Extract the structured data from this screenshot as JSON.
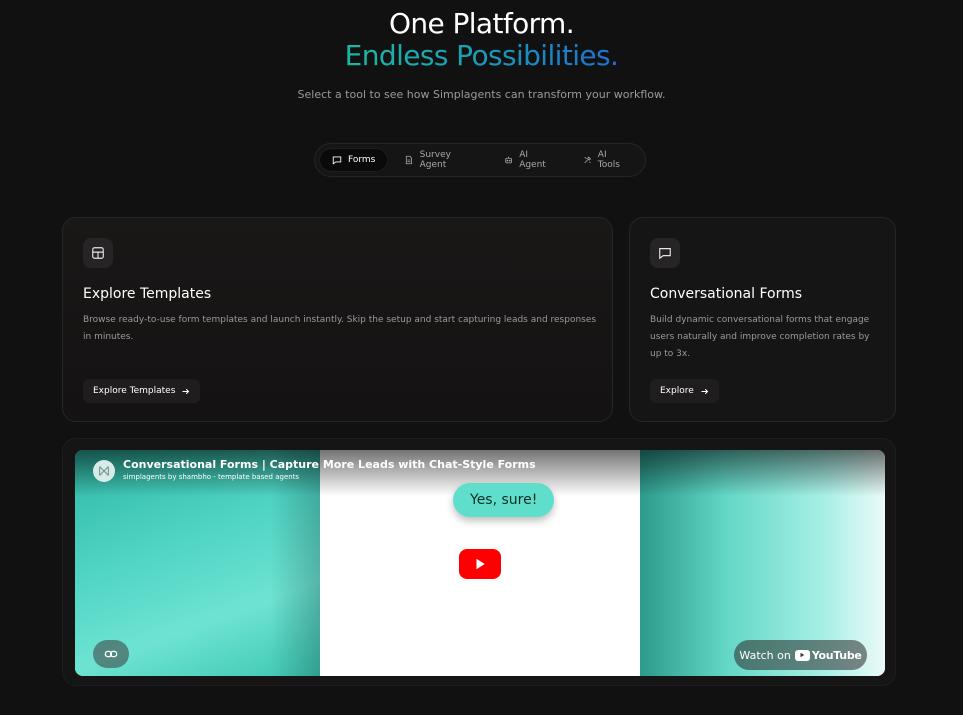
{
  "hero": {
    "title": "One Platform.",
    "accent": "Endless Possibilities.",
    "subtitle": "Select a tool to see how Simplagents can transform your workflow."
  },
  "tabs": [
    {
      "label": "Forms",
      "icon": "chat-icon",
      "active": true
    },
    {
      "label": "Survey Agent",
      "icon": "document-icon",
      "active": false
    },
    {
      "label": "AI Agent",
      "icon": "bot-icon",
      "active": false
    },
    {
      "label": "AI Tools",
      "icon": "tools-icon",
      "active": false
    }
  ],
  "cards": {
    "templates": {
      "icon": "layout-icon",
      "title": "Explore Templates",
      "description": "Browse ready-to-use form templates and launch instantly. Skip the setup and start capturing leads and responses in minutes.",
      "button": "Explore Templates"
    },
    "conversational": {
      "icon": "message-icon",
      "title": "Conversational Forms",
      "description": "Build dynamic conversational forms that engage users naturally and improve completion rates by up to 3x.",
      "button": "Explore"
    }
  },
  "video": {
    "title": "Conversational Forms | Capture More Leads with Chat-Style Forms",
    "channel": "simplagents by shambho - template based agents",
    "bubble": "Yes, sure!",
    "watch_prefix": "Watch on",
    "watch_brand": "YouTube",
    "colors": {
      "play": "#ff0000",
      "accent": "#5fdfcb"
    }
  }
}
